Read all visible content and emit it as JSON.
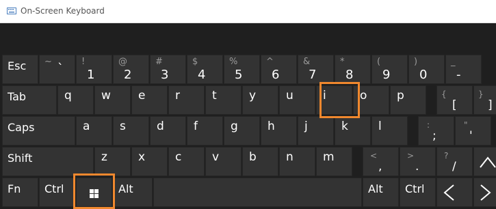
{
  "window": {
    "title": "On-Screen Keyboard"
  },
  "colors": {
    "highlight": "#f0882e",
    "key_bg": "#333333"
  },
  "row1": {
    "esc": "Esc",
    "keys": [
      {
        "shift": "~",
        "main": "`"
      },
      {
        "shift": "!",
        "main": "1"
      },
      {
        "shift": "@",
        "main": "2"
      },
      {
        "shift": "#",
        "main": "3"
      },
      {
        "shift": "$",
        "main": "4"
      },
      {
        "shift": "%",
        "main": "5"
      },
      {
        "shift": "^",
        "main": "6"
      },
      {
        "shift": "&",
        "main": "7"
      },
      {
        "shift": "*",
        "main": "8"
      },
      {
        "shift": "(",
        "main": "9"
      },
      {
        "shift": ")",
        "main": "0"
      },
      {
        "shift": "_",
        "main": "-"
      }
    ]
  },
  "row2": {
    "tab": "Tab",
    "letters": [
      "q",
      "w",
      "e",
      "r",
      "t",
      "y",
      "u",
      "i",
      "o",
      "p"
    ],
    "bracket": {
      "shift": "{",
      "main": "["
    },
    "brace2": {
      "shift": "}",
      "main": "]"
    }
  },
  "row3": {
    "caps": "Caps",
    "letters": [
      "a",
      "s",
      "d",
      "f",
      "g",
      "h",
      "j",
      "k",
      "l"
    ],
    "semicolon": {
      "shift": ":",
      "main": ";"
    },
    "quote": {
      "shift": "\"",
      "main": "'"
    }
  },
  "row4": {
    "shift": "Shift",
    "letters": [
      "z",
      "x",
      "c",
      "v",
      "b",
      "n",
      "m"
    ],
    "comma": {
      "shift": "<",
      "main": ","
    },
    "period": {
      "shift": ">",
      "main": "."
    },
    "slash": {
      "shift": "?",
      "main": "/"
    }
  },
  "row5": {
    "fn": "Fn",
    "ctrl": "Ctrl",
    "win_icon": "windows-logo-icon",
    "alt": "Alt",
    "alt_right": "Alt",
    "ctrl_right": "Ctrl",
    "left_arrow_icon": "chevron-left-icon",
    "right_arrow_icon": "chevron-right-icon",
    "up_arrow_icon": "chevron-up-icon"
  }
}
